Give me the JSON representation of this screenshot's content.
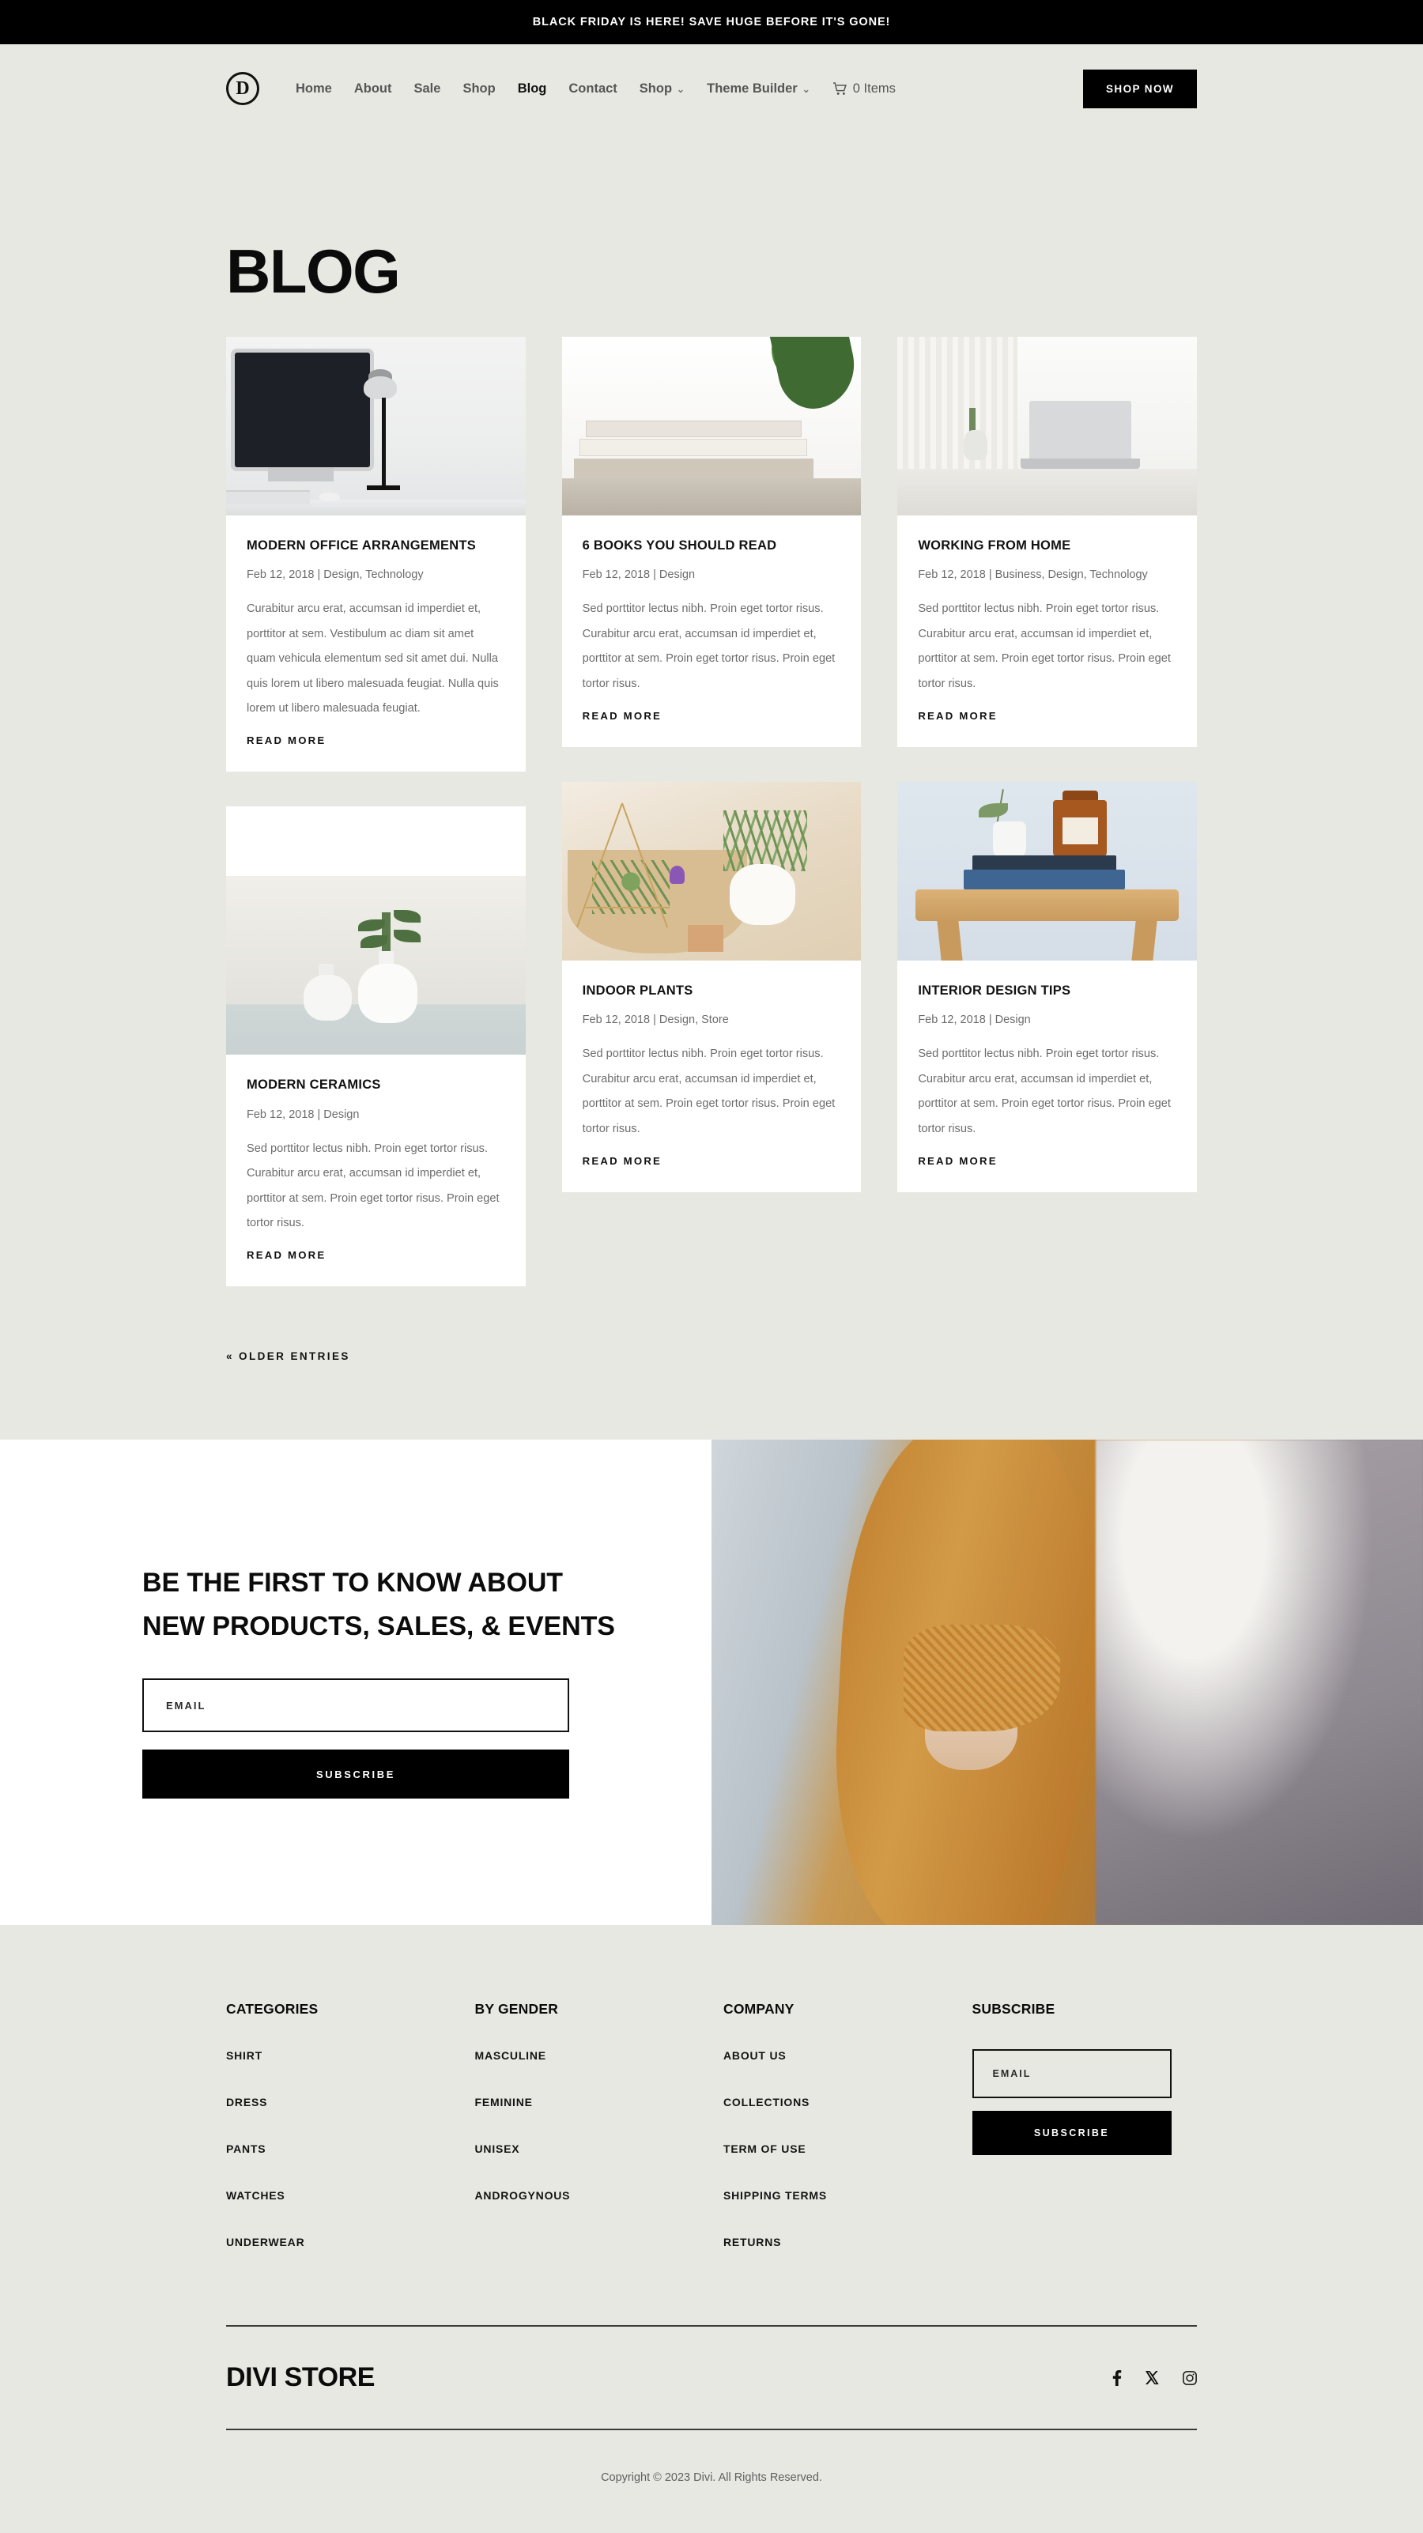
{
  "announcement": {
    "text": "BLACK FRIDAY IS HERE! SAVE HUGE BEFORE IT'S GONE!"
  },
  "header": {
    "logo_letter": "D",
    "nav": [
      {
        "label": "Home",
        "has_caret": false,
        "active": false
      },
      {
        "label": "About",
        "has_caret": false,
        "active": false
      },
      {
        "label": "Sale",
        "has_caret": false,
        "active": false
      },
      {
        "label": "Shop",
        "has_caret": false,
        "active": false
      },
      {
        "label": "Blog",
        "has_caret": false,
        "active": true
      },
      {
        "label": "Contact",
        "has_caret": false,
        "active": false
      },
      {
        "label": "Shop",
        "has_caret": true,
        "active": false
      },
      {
        "label": "Theme Builder",
        "has_caret": true,
        "active": false
      }
    ],
    "cart_label": "0 Items",
    "shop_now_label": "Shop Now"
  },
  "page": {
    "title": "BLOG",
    "pagination_label": "« Older Entries"
  },
  "posts": [
    {
      "title": "MODERN OFFICE ARRANGEMENTS",
      "meta": "Feb 12, 2018 | Design, Technology",
      "excerpt": "Curabitur arcu erat, accumsan id imperdiet et, porttitor at sem. Vestibulum ac diam sit amet quam vehicula elementum sed sit amet dui. Nulla quis lorem ut libero malesuada feugiat. Nulla quis lorem ut libero malesuada feugiat.",
      "read_more": "Read More",
      "image": "desk-with-monitor-and-lamp"
    },
    {
      "title": "MODERN CERAMICS",
      "meta": "Feb 12, 2018 | Design",
      "excerpt": "Sed porttitor lectus nibh. Proin eget tortor risus. Curabitur arcu erat, accumsan id imperdiet et, porttitor at sem. Proin eget tortor risus. Proin eget tortor risus.",
      "read_more": "Read More",
      "image": "white-ceramic-vases-with-sprig"
    },
    {
      "title": "6 BOOKS YOU SHOULD READ",
      "meta": "Feb 12, 2018 | Design",
      "excerpt": "Sed porttitor lectus nibh. Proin eget tortor risus. Curabitur arcu erat, accumsan id imperdiet et, porttitor at sem. Proin eget tortor risus. Proin eget tortor risus.",
      "read_more": "Read More",
      "image": "stacked-books-on-table"
    },
    {
      "title": "INDOOR PLANTS",
      "meta": "Feb 12, 2018 | Design, Store",
      "excerpt": "Sed porttitor lectus nibh. Proin eget tortor risus. Curabitur arcu erat, accumsan id imperdiet et, porttitor at sem. Proin eget tortor risus. Proin eget tortor risus.",
      "read_more": "Read More",
      "image": "air-plants-in-brass-himmeli"
    },
    {
      "title": "WORKING FROM HOME",
      "meta": "Feb 12, 2018 | Business, Design, Technology",
      "excerpt": "Sed porttitor lectus nibh. Proin eget tortor risus. Curabitur arcu erat, accumsan id imperdiet et, porttitor at sem. Proin eget tortor risus. Proin eget tortor risus.",
      "read_more": "Read More",
      "image": "laptop-desk-by-window"
    },
    {
      "title": "INTERIOR DESIGN TIPS",
      "meta": "Feb 12, 2018 | Design",
      "excerpt": "Sed porttitor lectus nibh. Proin eget tortor risus. Curabitur arcu erat, accumsan id imperdiet et, porttitor at sem. Proin eget tortor risus. Proin eget tortor risus.",
      "read_more": "Read More",
      "image": "books-and-amber-bottle-on-stool"
    }
  ],
  "newsletter": {
    "heading": "BE THE FIRST TO KNOW ABOUT NEW PRODUCTS, SALES, & EVENTS",
    "email_placeholder": "Email",
    "subscribe_label": "Subscribe",
    "image": "woman-in-mustard-sweater"
  },
  "footer": {
    "columns": [
      {
        "heading": "Categories",
        "links": [
          "Shirt",
          "Dress",
          "Pants",
          "Watches",
          "Underwear"
        ]
      },
      {
        "heading": "By Gender",
        "links": [
          "Masculine",
          "Feminine",
          "Unisex",
          "Androgynous"
        ]
      },
      {
        "heading": "Company",
        "links": [
          "About Us",
          "Collections",
          "Term of Use",
          "Shipping Terms",
          "Returns"
        ]
      }
    ],
    "subscribe": {
      "heading": "Subscribe",
      "email_placeholder": "Email",
      "button_label": "Subscribe"
    },
    "brand": "DIVI STORE",
    "socials": [
      "facebook-icon",
      "x-twitter-icon",
      "instagram-icon"
    ],
    "copyright": "Copyright © 2023 Divi. All Rights Reserved."
  },
  "colors": {
    "page_bg": "#e8e8e3",
    "card_bg": "#ffffff",
    "ink": "#111111",
    "muted": "#6c6c6c",
    "accent": "#000000"
  }
}
